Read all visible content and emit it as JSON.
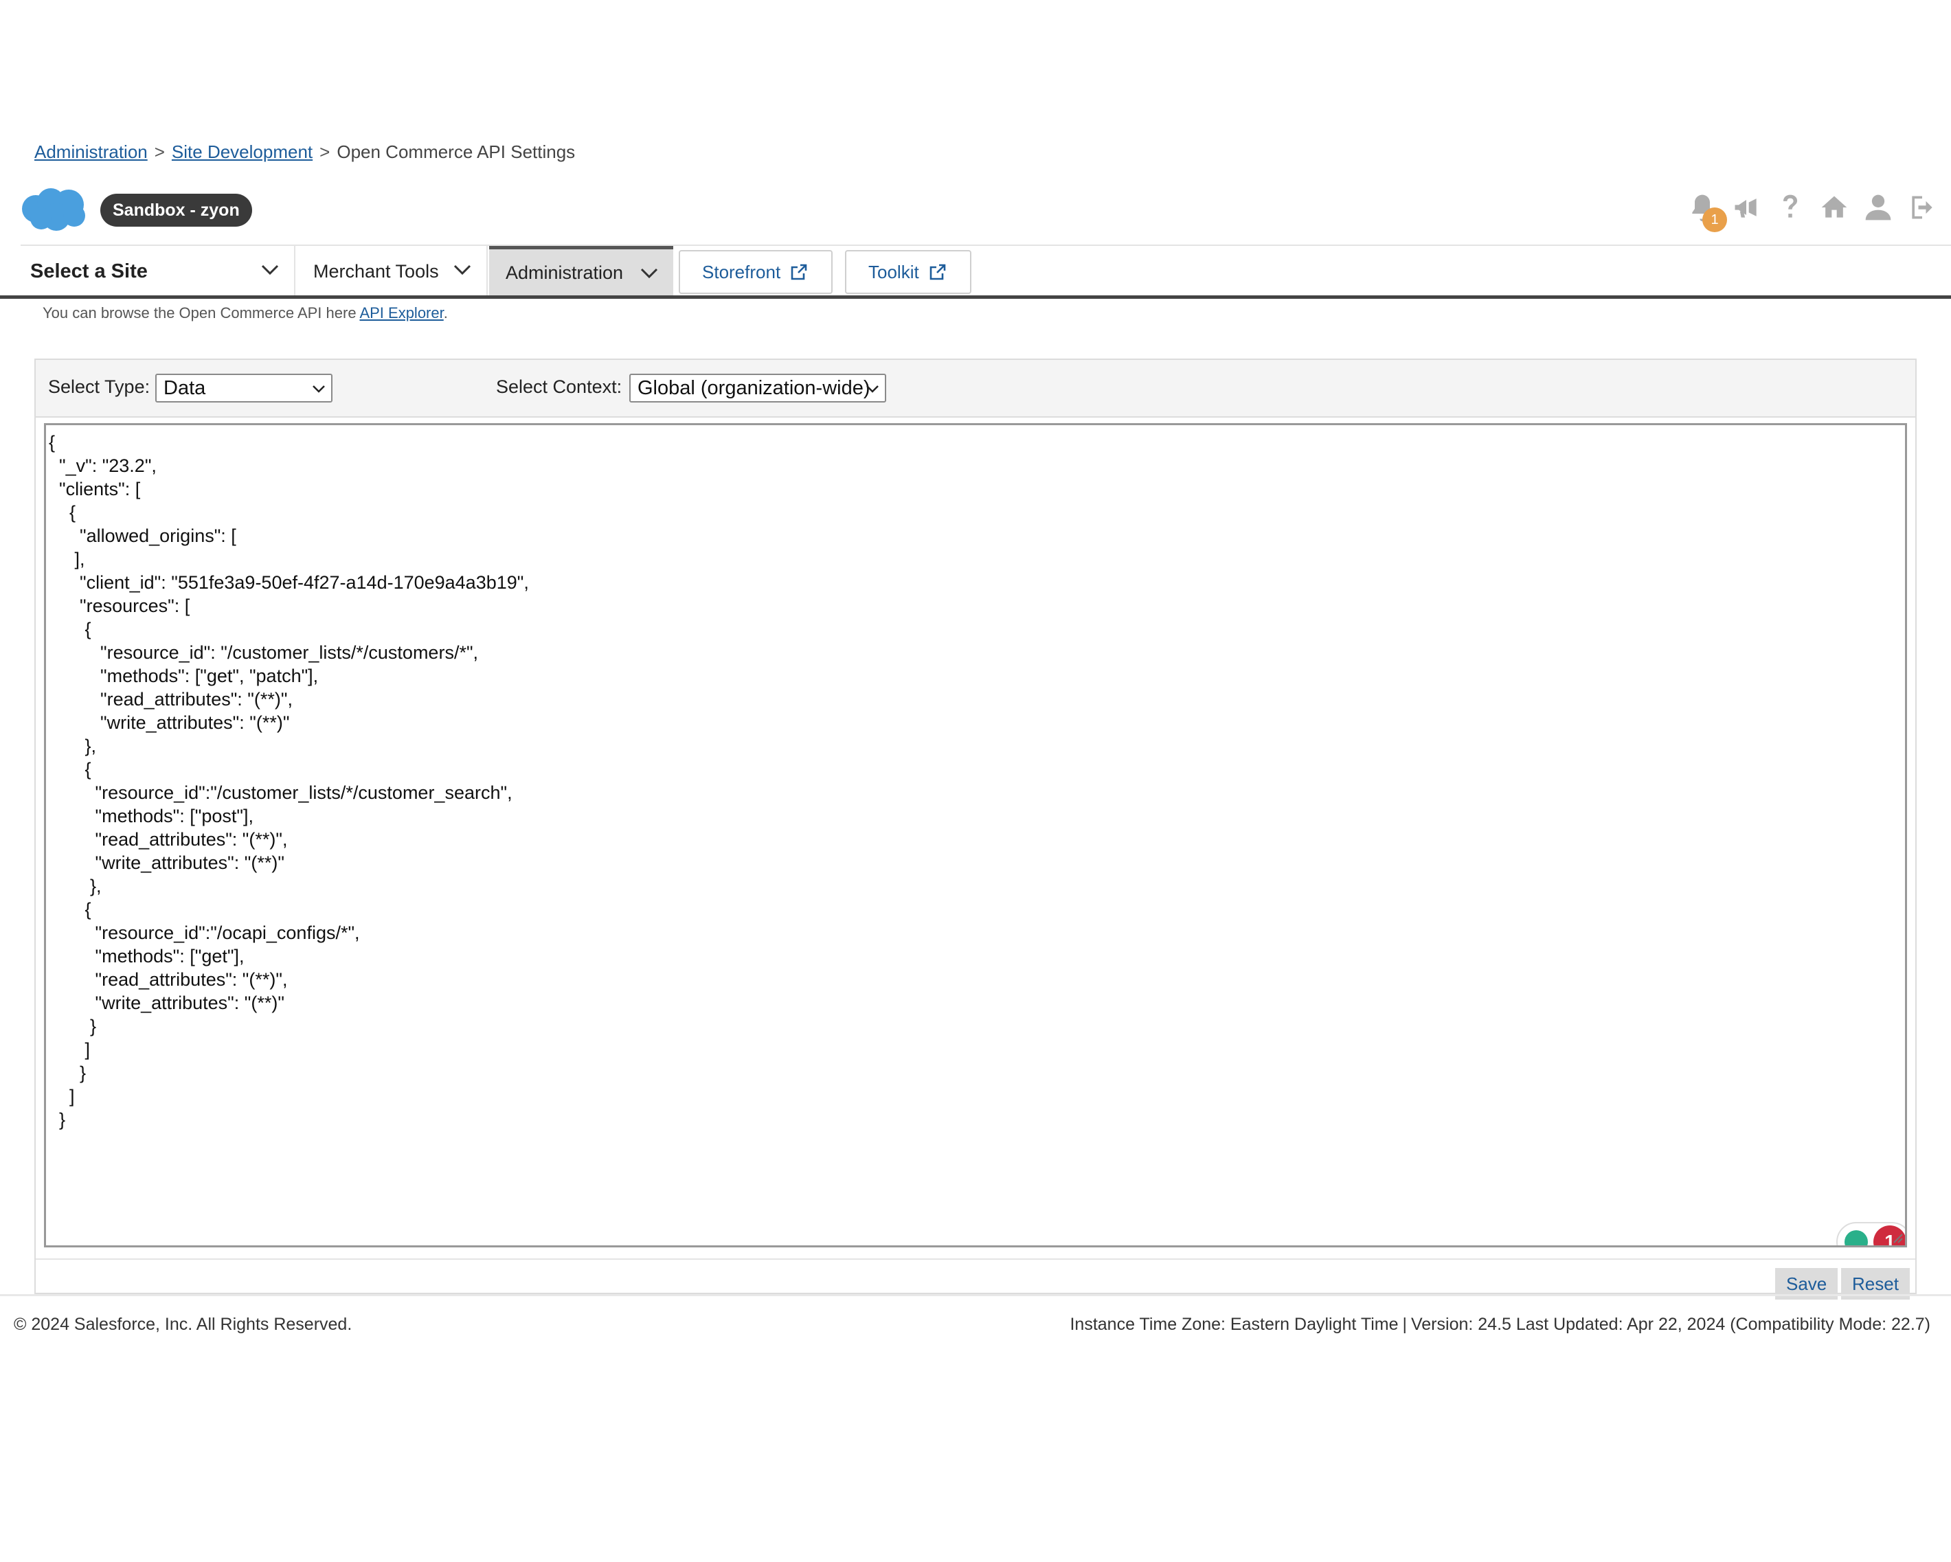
{
  "breadcrumb": {
    "items": [
      "Administration",
      "Site Development"
    ],
    "separator": ">",
    "current": "Open Commerce API Settings"
  },
  "brand": {
    "logo": "salesforce-cloud-icon",
    "sandbox_label": "Sandbox - zyon",
    "brand_color": "#4a9fde"
  },
  "utility": {
    "notification_count": "1",
    "icons": [
      "bell-icon",
      "megaphone-icon",
      "help-icon",
      "home-icon",
      "user-icon",
      "logout-icon"
    ]
  },
  "nav": {
    "site_select": "Select a Site",
    "merchant_tools": "Merchant Tools",
    "administration": "Administration",
    "storefront": "Storefront",
    "toolkit": "Toolkit"
  },
  "info": {
    "text": "You can browse the Open Commerce API here ",
    "link": "API Explorer",
    "suffix": "."
  },
  "form": {
    "type_label": "Select Type:",
    "type_value": "Data",
    "context_label": "Select Context:",
    "context_value": "Global (organization-wide)",
    "editor_content": "{\n  \"_v\": \"23.2\",\n  \"clients\": [\n    {\n      \"allowed_origins\": [\n     ],\n      \"client_id\": \"551fe3a9-50ef-4f27-a14d-170e9a4a3b19\",\n      \"resources\": [\n       {\n          \"resource_id\": \"/customer_lists/*/customers/*\",\n          \"methods\": [\"get\", \"patch\"],\n          \"read_attributes\": \"(**)\",\n          \"write_attributes\": \"(**)\"\n       },\n       {\n         \"resource_id\":\"/customer_lists/*/customer_search\",\n         \"methods\": [\"post\"],\n         \"read_attributes\": \"(**)\",\n         \"write_attributes\": \"(**)\"\n        },\n       {\n         \"resource_id\":\"/ocapi_configs/*\",\n         \"methods\": [\"get\"],\n         \"read_attributes\": \"(**)\",\n         \"write_attributes\": \"(**)\"\n        }\n       ]\n      }\n    ]\n  }",
    "grammar_count": "1",
    "save": "Save",
    "reset": "Reset"
  },
  "footer": {
    "copyright": "© 2024 Salesforce, Inc. All Rights Reserved.",
    "timezone": "Instance Time Zone: Eastern Daylight Time",
    "divider": "|",
    "version": "Version: 24.5 Last Updated: Apr 22, 2024 (Compatibility Mode: 22.7)"
  },
  "colors": {
    "link": "#1d5c9a",
    "badge_dark": "#3a3a3a",
    "notification": "#e9a04a",
    "grammar_error": "#cf2b3e"
  }
}
